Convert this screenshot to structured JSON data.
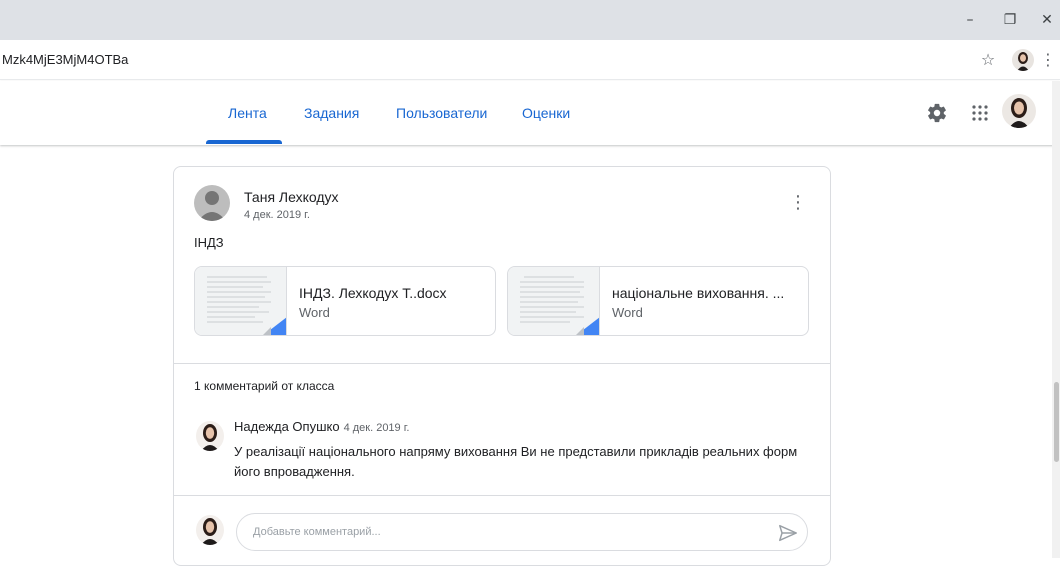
{
  "browser": {
    "url_fragment": "Mzk4MjE3MjM4OTBa",
    "controls": {
      "minimize": "–",
      "maximize": "❐",
      "close": "✕"
    },
    "star_icon": "☆",
    "menu_icon": "⋮"
  },
  "header": {
    "tabs": [
      {
        "label": "Лента",
        "active": true
      },
      {
        "label": "Задания",
        "active": false
      },
      {
        "label": "Пользователи",
        "active": false
      },
      {
        "label": "Оценки",
        "active": false
      }
    ],
    "settings_icon": "⚙",
    "apps_icon": "⋮⋮⋮"
  },
  "post": {
    "author": "Таня Лехкодух",
    "date": "4 дек. 2019 г.",
    "menu_icon": "⋮",
    "text": "ІНДЗ",
    "attachments": [
      {
        "title": "ІНДЗ. Лехкодух Т..docx",
        "type": "Word"
      },
      {
        "title": "національне виховання. ...",
        "type": "Word"
      }
    ],
    "comments_header": "1 комментарий от класса",
    "comments": [
      {
        "author": "Надежда Опушко",
        "date": "4 дек. 2019 г.",
        "text": "У реалізації національного напряму виховання Ви не представили прикладів реальних форм його впровадження."
      }
    ],
    "comment_placeholder": "Добавьте комментарий..."
  },
  "colors": {
    "accent": "#1967d2",
    "divider": "#dadce0",
    "word_blue": "#4285f4"
  }
}
